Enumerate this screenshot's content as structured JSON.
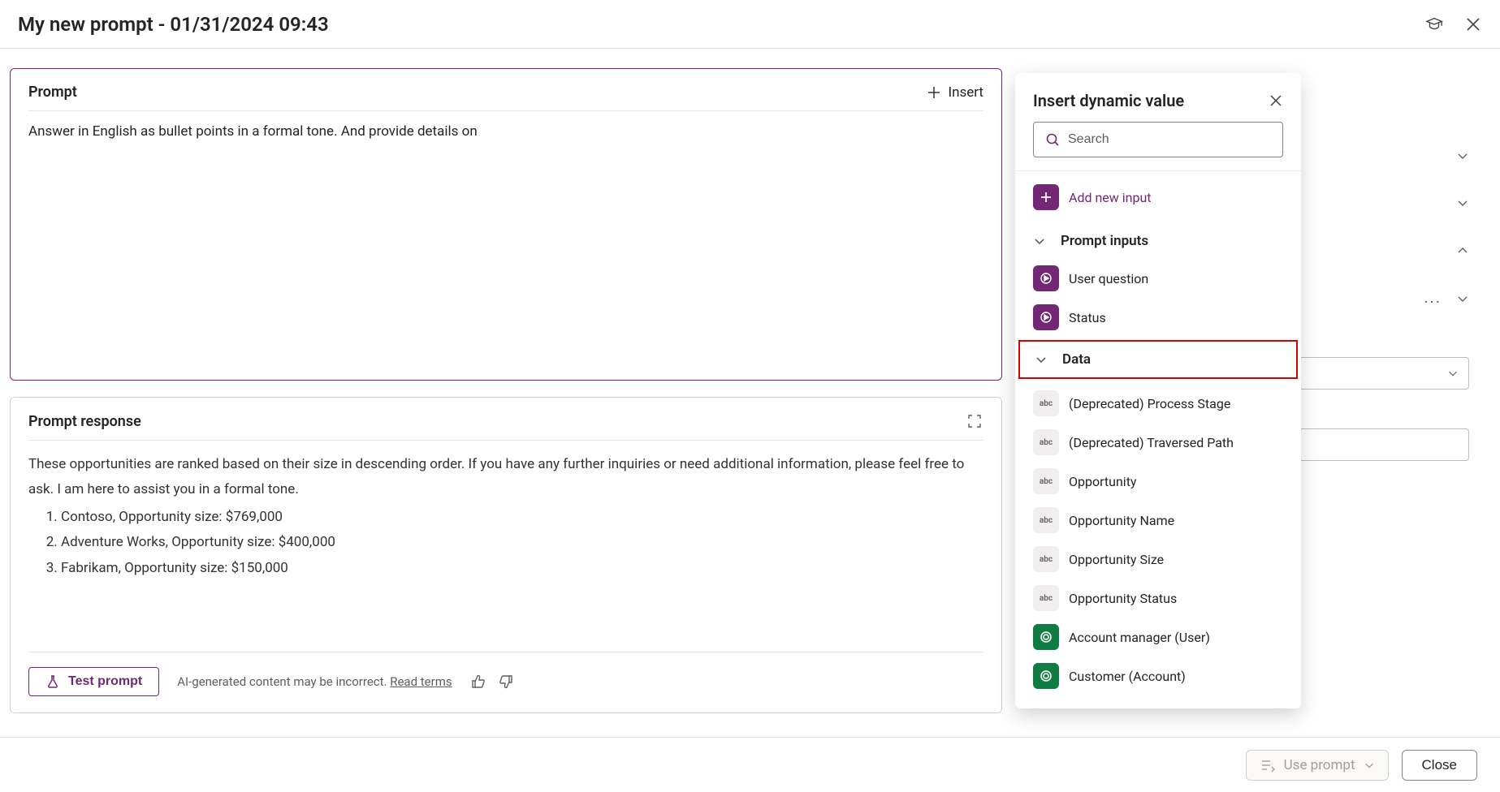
{
  "header": {
    "title": "My new prompt - 01/31/2024 09:43"
  },
  "prompt": {
    "card_title": "Prompt",
    "insert_label": "Insert",
    "text": "Answer in English as bullet points in a formal tone. And provide details on"
  },
  "response": {
    "card_title": "Prompt response",
    "intro": "These opportunities are ranked based on their size in descending order. If you have any further inquiries or need additional information, please feel free to ask. I am here to assist you in a formal tone.",
    "items": [
      "Contoso, Opportunity size: $769,000",
      "Adventure Works, Opportunity size: $400,000",
      "Fabrikam, Opportunity size: $150,000"
    ],
    "test_label": "Test prompt",
    "disclaimer_text": "AI-generated content may be incorrect. ",
    "read_terms": "Read terms"
  },
  "popup": {
    "title": "Insert dynamic value",
    "search_placeholder": "Search",
    "add_new_label": "Add new input",
    "section_inputs": "Prompt inputs",
    "inputs": [
      {
        "label": "User question"
      },
      {
        "label": "Status"
      }
    ],
    "section_data": "Data",
    "data_items": [
      {
        "label": "(Deprecated) Process Stage",
        "icon": "abc"
      },
      {
        "label": "(Deprecated) Traversed Path",
        "icon": "abc"
      },
      {
        "label": "Opportunity",
        "icon": "abc"
      },
      {
        "label": "Opportunity Name",
        "icon": "abc"
      },
      {
        "label": "Opportunity Size",
        "icon": "abc"
      },
      {
        "label": "Opportunity Status",
        "icon": "abc"
      },
      {
        "label": "Account manager (User)",
        "icon": "link"
      },
      {
        "label": "Customer (Account)",
        "icon": "link"
      }
    ]
  },
  "footer": {
    "use_label": "Use prompt",
    "close_label": "Close"
  }
}
